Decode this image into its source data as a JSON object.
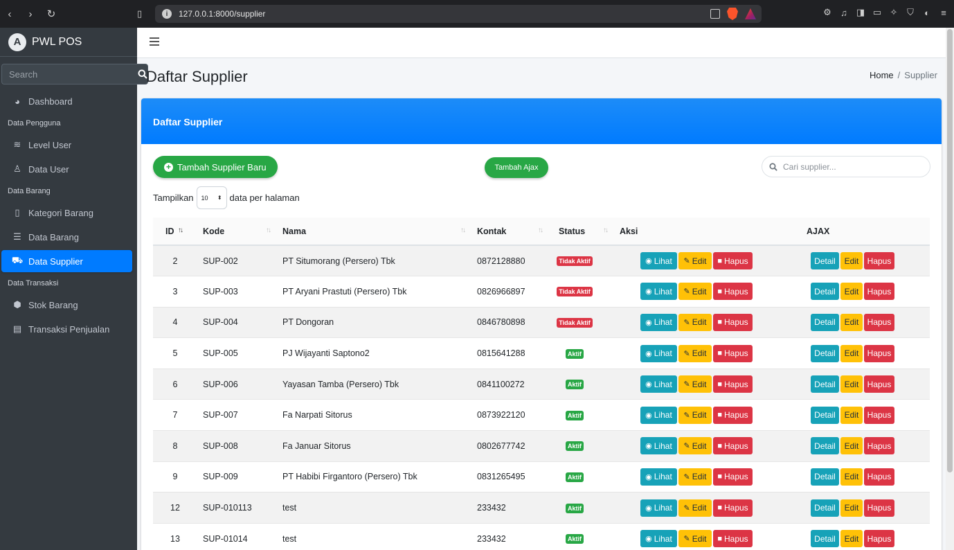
{
  "browser": {
    "url": "127.0.0.1:8000/supplier"
  },
  "brand": {
    "logo_letter": "A",
    "title": "PWL POS"
  },
  "sidebar": {
    "search_placeholder": "Search",
    "items": [
      {
        "type": "item",
        "label": "Dashboard",
        "icon": "dashboard-icon",
        "glyph": "◕",
        "active": false
      },
      {
        "type": "header",
        "label": "Data Pengguna"
      },
      {
        "type": "item",
        "label": "Level User",
        "icon": "layers-icon",
        "glyph": "≋",
        "active": false
      },
      {
        "type": "item",
        "label": "Data User",
        "icon": "user-icon",
        "glyph": "♙",
        "active": false
      },
      {
        "type": "header",
        "label": "Data Barang"
      },
      {
        "type": "item",
        "label": "Kategori Barang",
        "icon": "bookmark-icon",
        "glyph": "▯",
        "active": false
      },
      {
        "type": "item",
        "label": "Data Barang",
        "icon": "list-icon",
        "glyph": "☰",
        "active": false
      },
      {
        "type": "item",
        "label": "Data Supplier",
        "icon": "truck-icon",
        "glyph": "⛟",
        "active": true
      },
      {
        "type": "header",
        "label": "Data Transaksi"
      },
      {
        "type": "item",
        "label": "Stok Barang",
        "icon": "cubes-icon",
        "glyph": "⬢",
        "active": false
      },
      {
        "type": "item",
        "label": "Transaksi Penjualan",
        "icon": "cash-register-icon",
        "glyph": "▤",
        "active": false
      }
    ]
  },
  "page": {
    "title": "Daftar Supplier",
    "breadcrumb": {
      "home": "Home",
      "separator": "/",
      "current": "Supplier"
    }
  },
  "card": {
    "header": "Daftar Supplier",
    "add_button": "Tambah Supplier Baru",
    "ajax_button": "Tambah Ajax",
    "search_placeholder": "Cari supplier...",
    "length": {
      "prefix": "Tampilkan",
      "value": "10",
      "suffix": "data per halaman"
    }
  },
  "table": {
    "columns": [
      "ID",
      "Kode",
      "Nama",
      "Kontak",
      "Status",
      "Aksi",
      "AJAX"
    ],
    "action_labels": {
      "lihat": "Lihat",
      "edit": "Edit",
      "hapus": "Hapus",
      "detail": "Detail",
      "ajax_edit": "Edit",
      "ajax_hapus": "Hapus"
    },
    "rows": [
      {
        "id": "2",
        "kode": "SUP-002",
        "nama": "PT Situmorang (Persero) Tbk",
        "kontak": "0872128880",
        "status": "Tidak Aktif",
        "active": false
      },
      {
        "id": "3",
        "kode": "SUP-003",
        "nama": "PT Aryani Prastuti (Persero) Tbk",
        "kontak": "0826966897",
        "status": "Tidak Aktif",
        "active": false
      },
      {
        "id": "4",
        "kode": "SUP-004",
        "nama": "PT Dongoran",
        "kontak": "0846780898",
        "status": "Tidak Aktif",
        "active": false
      },
      {
        "id": "5",
        "kode": "SUP-005",
        "nama": "PJ Wijayanti Saptono2",
        "kontak": "0815641288",
        "status": "Aktif",
        "active": true
      },
      {
        "id": "6",
        "kode": "SUP-006",
        "nama": "Yayasan Tamba (Persero) Tbk",
        "kontak": "0841100272",
        "status": "Aktif",
        "active": true
      },
      {
        "id": "7",
        "kode": "SUP-007",
        "nama": "Fa Narpati Sitorus",
        "kontak": "0873922120",
        "status": "Aktif",
        "active": true
      },
      {
        "id": "8",
        "kode": "SUP-008",
        "nama": "Fa Januar Sitorus",
        "kontak": "0802677742",
        "status": "Aktif",
        "active": true
      },
      {
        "id": "9",
        "kode": "SUP-009",
        "nama": "PT Habibi Firgantoro (Persero) Tbk",
        "kontak": "0831265495",
        "status": "Aktif",
        "active": true
      },
      {
        "id": "12",
        "kode": "SUP-010113",
        "nama": "test",
        "kontak": "233432",
        "status": "Aktif",
        "active": true
      },
      {
        "id": "13",
        "kode": "SUP-01014",
        "nama": "test",
        "kontak": "233432",
        "status": "Aktif",
        "active": true
      }
    ]
  },
  "colors": {
    "primary": "#007bff",
    "success": "#28a745",
    "info": "#17a2b8",
    "warning": "#ffc107",
    "danger": "#dc3545",
    "sidebar": "#343a40"
  }
}
